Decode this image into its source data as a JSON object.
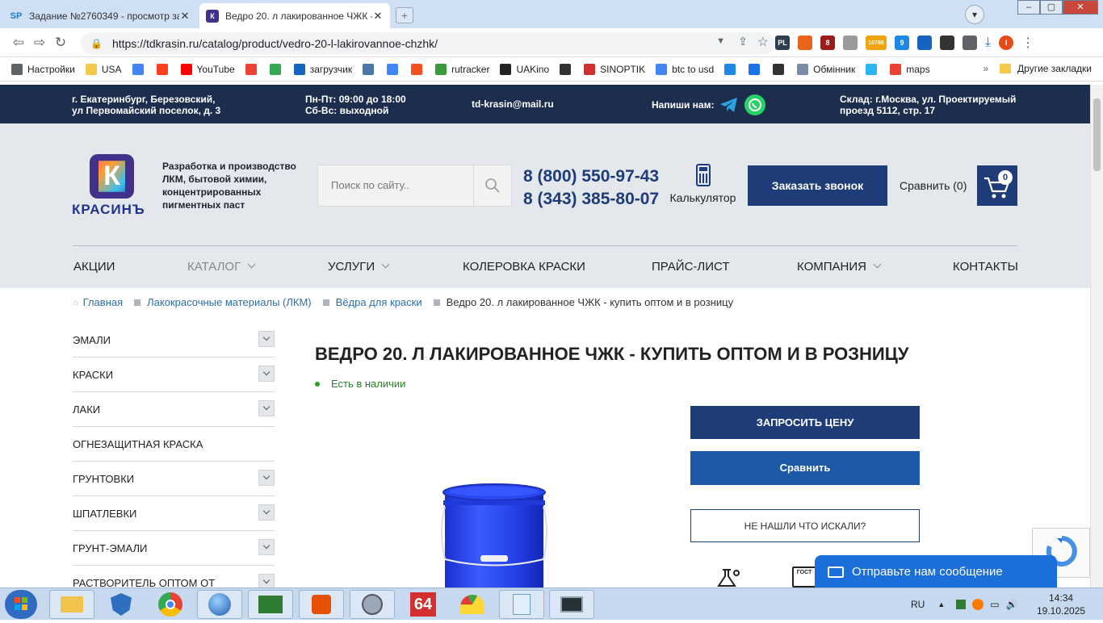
{
  "browser": {
    "tabs": [
      {
        "favicon": "SP",
        "title": "Задание №2760349 - просмотр за"
      },
      {
        "favicon": "К",
        "title": "Ведро 20. л лакированное ЧЖК -"
      }
    ],
    "profile_initial": "I",
    "url": "https://tdkrasin.ru/catalog/product/vedro-20-l-lakirovannoe-chzhk/",
    "extension_badges": [
      "PL",
      "8",
      "10788",
      "9"
    ],
    "bookmarks": [
      {
        "label": "Настройки",
        "icon": "gear-icon",
        "color": "#5f6368"
      },
      {
        "label": "USA",
        "icon": "folder-icon",
        "color": "#f3c84b"
      },
      {
        "label": "",
        "icon": "google-icon",
        "color": "#4285f4"
      },
      {
        "label": "",
        "icon": "yandex-icon",
        "color": "#fc3f1d"
      },
      {
        "label": "YouTube",
        "icon": "youtube-icon",
        "color": "#ff0000"
      },
      {
        "label": "",
        "icon": "gmail-icon",
        "color": "#ea4335"
      },
      {
        "label": "",
        "icon": "drive-icon",
        "color": "#34a853"
      },
      {
        "label": "загрузчик",
        "icon": "loop-icon",
        "color": "#1565c0"
      },
      {
        "label": "",
        "icon": "vk-icon",
        "color": "#4a76a8"
      },
      {
        "label": "",
        "icon": "translate-icon",
        "color": "#4285f4"
      },
      {
        "label": "",
        "icon": "f-icon",
        "color": "#f25022"
      },
      {
        "label": "rutracker",
        "icon": "rutracker-icon",
        "color": "#3a9a3a"
      },
      {
        "label": "UAKino",
        "icon": "uakino-icon",
        "color": "#222222"
      },
      {
        "label": "",
        "icon": "chess-icon",
        "color": "#333333"
      },
      {
        "label": "SINOPTIK",
        "icon": "thermometer-icon",
        "color": "#d32f2f"
      },
      {
        "label": "btc to usd",
        "icon": "google-icon",
        "color": "#4285f4"
      },
      {
        "label": "",
        "icon": "p-icon",
        "color": "#1e88e5"
      },
      {
        "label": "",
        "icon": "arrow-icon",
        "color": "#1a73e8"
      },
      {
        "label": "",
        "icon": "bc-icon",
        "color": "#333333"
      },
      {
        "label": "Обмінник",
        "icon": "exchange-icon",
        "color": "#7b8ca8"
      },
      {
        "label": "",
        "icon": "star-icon",
        "color": "#29b6f6"
      },
      {
        "label": "maps",
        "icon": "maps-icon",
        "color": "#ea4335"
      }
    ],
    "other_bookmarks": "Другие закладки"
  },
  "topbar": {
    "address": "г. Екатеринбург, Березовский,\nул Первомайский поселок, д. 3",
    "hours_weekdays": "Пн-Пт: 09:00 до 18:00",
    "hours_weekend": "Сб-Вс: выходной",
    "email": "td-krasin@mail.ru",
    "write_us": "Напиши нам:",
    "warehouse_line1": "Склад: г.Москва, ул. Проектируемый",
    "warehouse_line2": "проезд 5112, стр. 17"
  },
  "header": {
    "logo_letter": "К",
    "logo_text": "КРАСИНЪ",
    "tagline": "Разработка и производство ЛКМ, бытовой химии, концентрированных пигментных паст",
    "search_placeholder": "Поиск по сайту..",
    "phone1": "8 (800) 550-97-43",
    "phone2": "8 (343) 385-80-07",
    "calculator": "Калькулятор",
    "order_call": "Заказать звонок",
    "compare": "Сравнить (0)",
    "cart_count": "0"
  },
  "menu": [
    "Акции",
    "Каталог",
    "Услуги",
    "Колеровка краски",
    "Прайс-лист",
    "Компания",
    "Контакты"
  ],
  "breadcrumbs": {
    "home": "Главная",
    "level1": "Лакокрасочные материалы (ЛКМ)",
    "level2": "Вёдра для краски",
    "current": "Ведро 20. л лакированное ЧЖК - купить оптом и в розницу"
  },
  "sidebar": [
    {
      "label": "Эмали",
      "expandable": true
    },
    {
      "label": "Краски",
      "expandable": true
    },
    {
      "label": "Лаки",
      "expandable": true
    },
    {
      "label": "Огнезащитная краска",
      "expandable": false
    },
    {
      "label": "Грунтовки",
      "expandable": true
    },
    {
      "label": "Шпатлевки",
      "expandable": true
    },
    {
      "label": "Грунт-эмали",
      "expandable": true
    },
    {
      "label": "Растворитель оптом от",
      "expandable": true
    }
  ],
  "product": {
    "title": "Ведро 20. л лакированное ЧЖК - купить оптом и в розницу",
    "availability": "Есть в наличии",
    "request_price": "Запросить цену",
    "compare": "Сравнить",
    "not_found": "Не нашли что искали?",
    "gost_label": "ГОСТ"
  },
  "chat": {
    "label": "Отправьте нам сообщение"
  },
  "taskbar": {
    "lang": "RU",
    "time": "14:34",
    "date": "19.10.2025",
    "badge_64": "64"
  },
  "colors": {
    "navy": "#1d2d4e",
    "brand_blue": "#1d3c78",
    "compare_blue": "#1c5aa8",
    "stock_green": "#2d7d2d"
  }
}
